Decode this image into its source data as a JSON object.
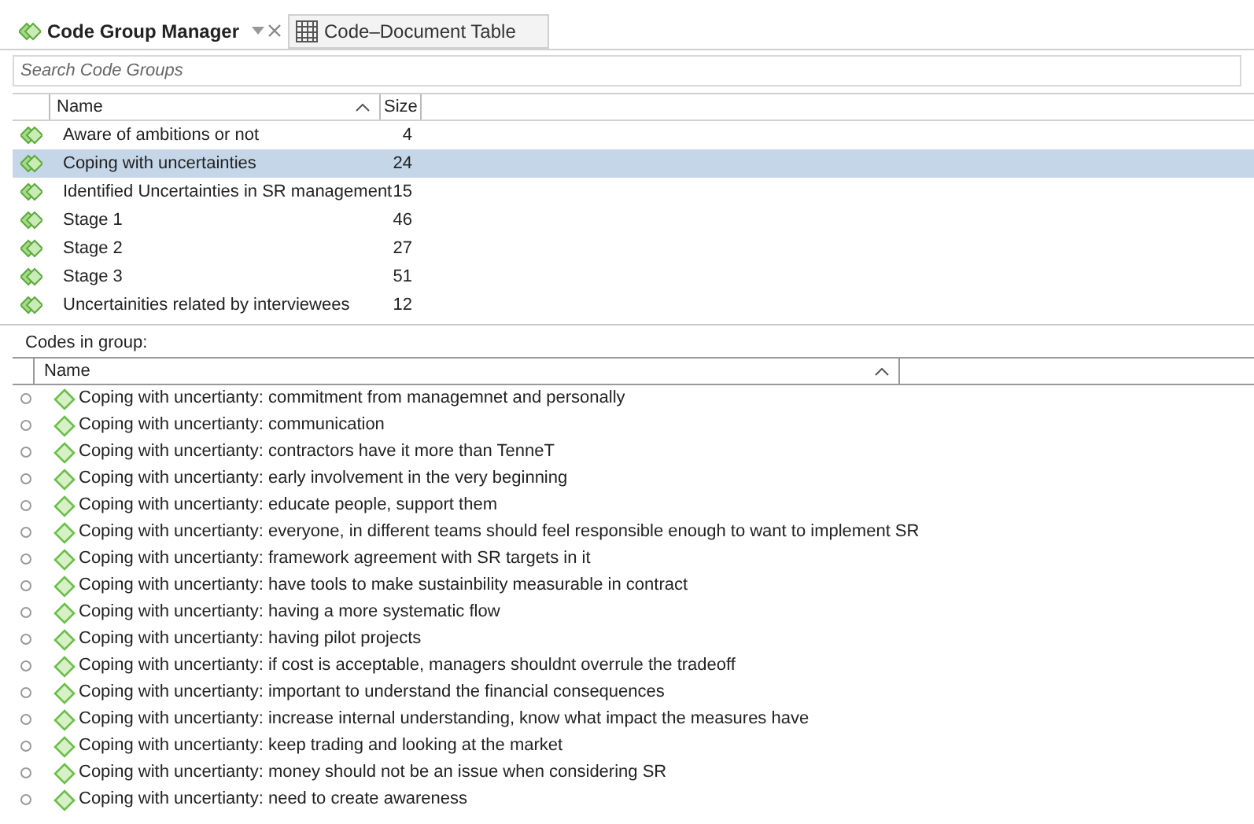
{
  "tabs": [
    {
      "label": "Code Group Manager",
      "selected": true,
      "kind": "groups"
    },
    {
      "label": "Code–Document Table",
      "selected": false,
      "kind": "table"
    }
  ],
  "search": {
    "placeholder": "Search Code Groups"
  },
  "groups_table": {
    "columns": [
      "Name",
      "Size"
    ],
    "rows": [
      {
        "name": "Aware of ambitions or not",
        "size": "4",
        "selected": false
      },
      {
        "name": "Coping with uncertainties",
        "size": "24",
        "selected": true
      },
      {
        "name": "Identified Uncertainties in SR management",
        "size": "15",
        "selected": false
      },
      {
        "name": "Stage 1",
        "size": "46",
        "selected": false
      },
      {
        "name": "Stage 2",
        "size": "27",
        "selected": false
      },
      {
        "name": "Stage 3",
        "size": "51",
        "selected": false
      },
      {
        "name": "Uncertainities related by interviewees",
        "size": "12",
        "selected": false
      }
    ]
  },
  "codes_label": "Codes in group:",
  "codes_table": {
    "columns": [
      "Name"
    ],
    "rows": [
      {
        "name": "Coping with uncertianty: commitment from managemnet and personally",
        "selected": false
      },
      {
        "name": "Coping with uncertianty: communication",
        "selected": false
      },
      {
        "name": "Coping with uncertianty: contractors have it more than TenneT",
        "selected": false
      },
      {
        "name": "Coping with uncertianty: early involvement in the very beginning",
        "selected": false
      },
      {
        "name": "Coping with uncertianty: educate people, support them",
        "selected": false
      },
      {
        "name": "Coping with uncertianty: everyone, in different teams should feel responsible enough to want to implement SR",
        "selected": false
      },
      {
        "name": "Coping with uncertianty: framework agreement with SR targets in it",
        "selected": false
      },
      {
        "name": "Coping with uncertianty: have tools to make sustainbility measurable in contract",
        "selected": false
      },
      {
        "name": "Coping with uncertianty: having a more systematic flow",
        "selected": false
      },
      {
        "name": "Coping with uncertianty: having pilot projects",
        "selected": false
      },
      {
        "name": "Coping with uncertianty: if cost is acceptable, managers shouldnt overrule the tradeoff",
        "selected": false
      },
      {
        "name": "Coping with uncertianty: important to understand the financial consequences",
        "selected": false
      },
      {
        "name": "Coping with uncertianty: increase internal understanding, know what impact the measures have",
        "selected": false
      },
      {
        "name": "Coping with uncertianty: keep trading and looking at the market",
        "selected": false
      },
      {
        "name": "Coping with uncertianty: money should not be an issue when considering SR",
        "selected": false
      },
      {
        "name": "Coping with uncertianty: need to create awareness",
        "selected": false
      }
    ]
  }
}
